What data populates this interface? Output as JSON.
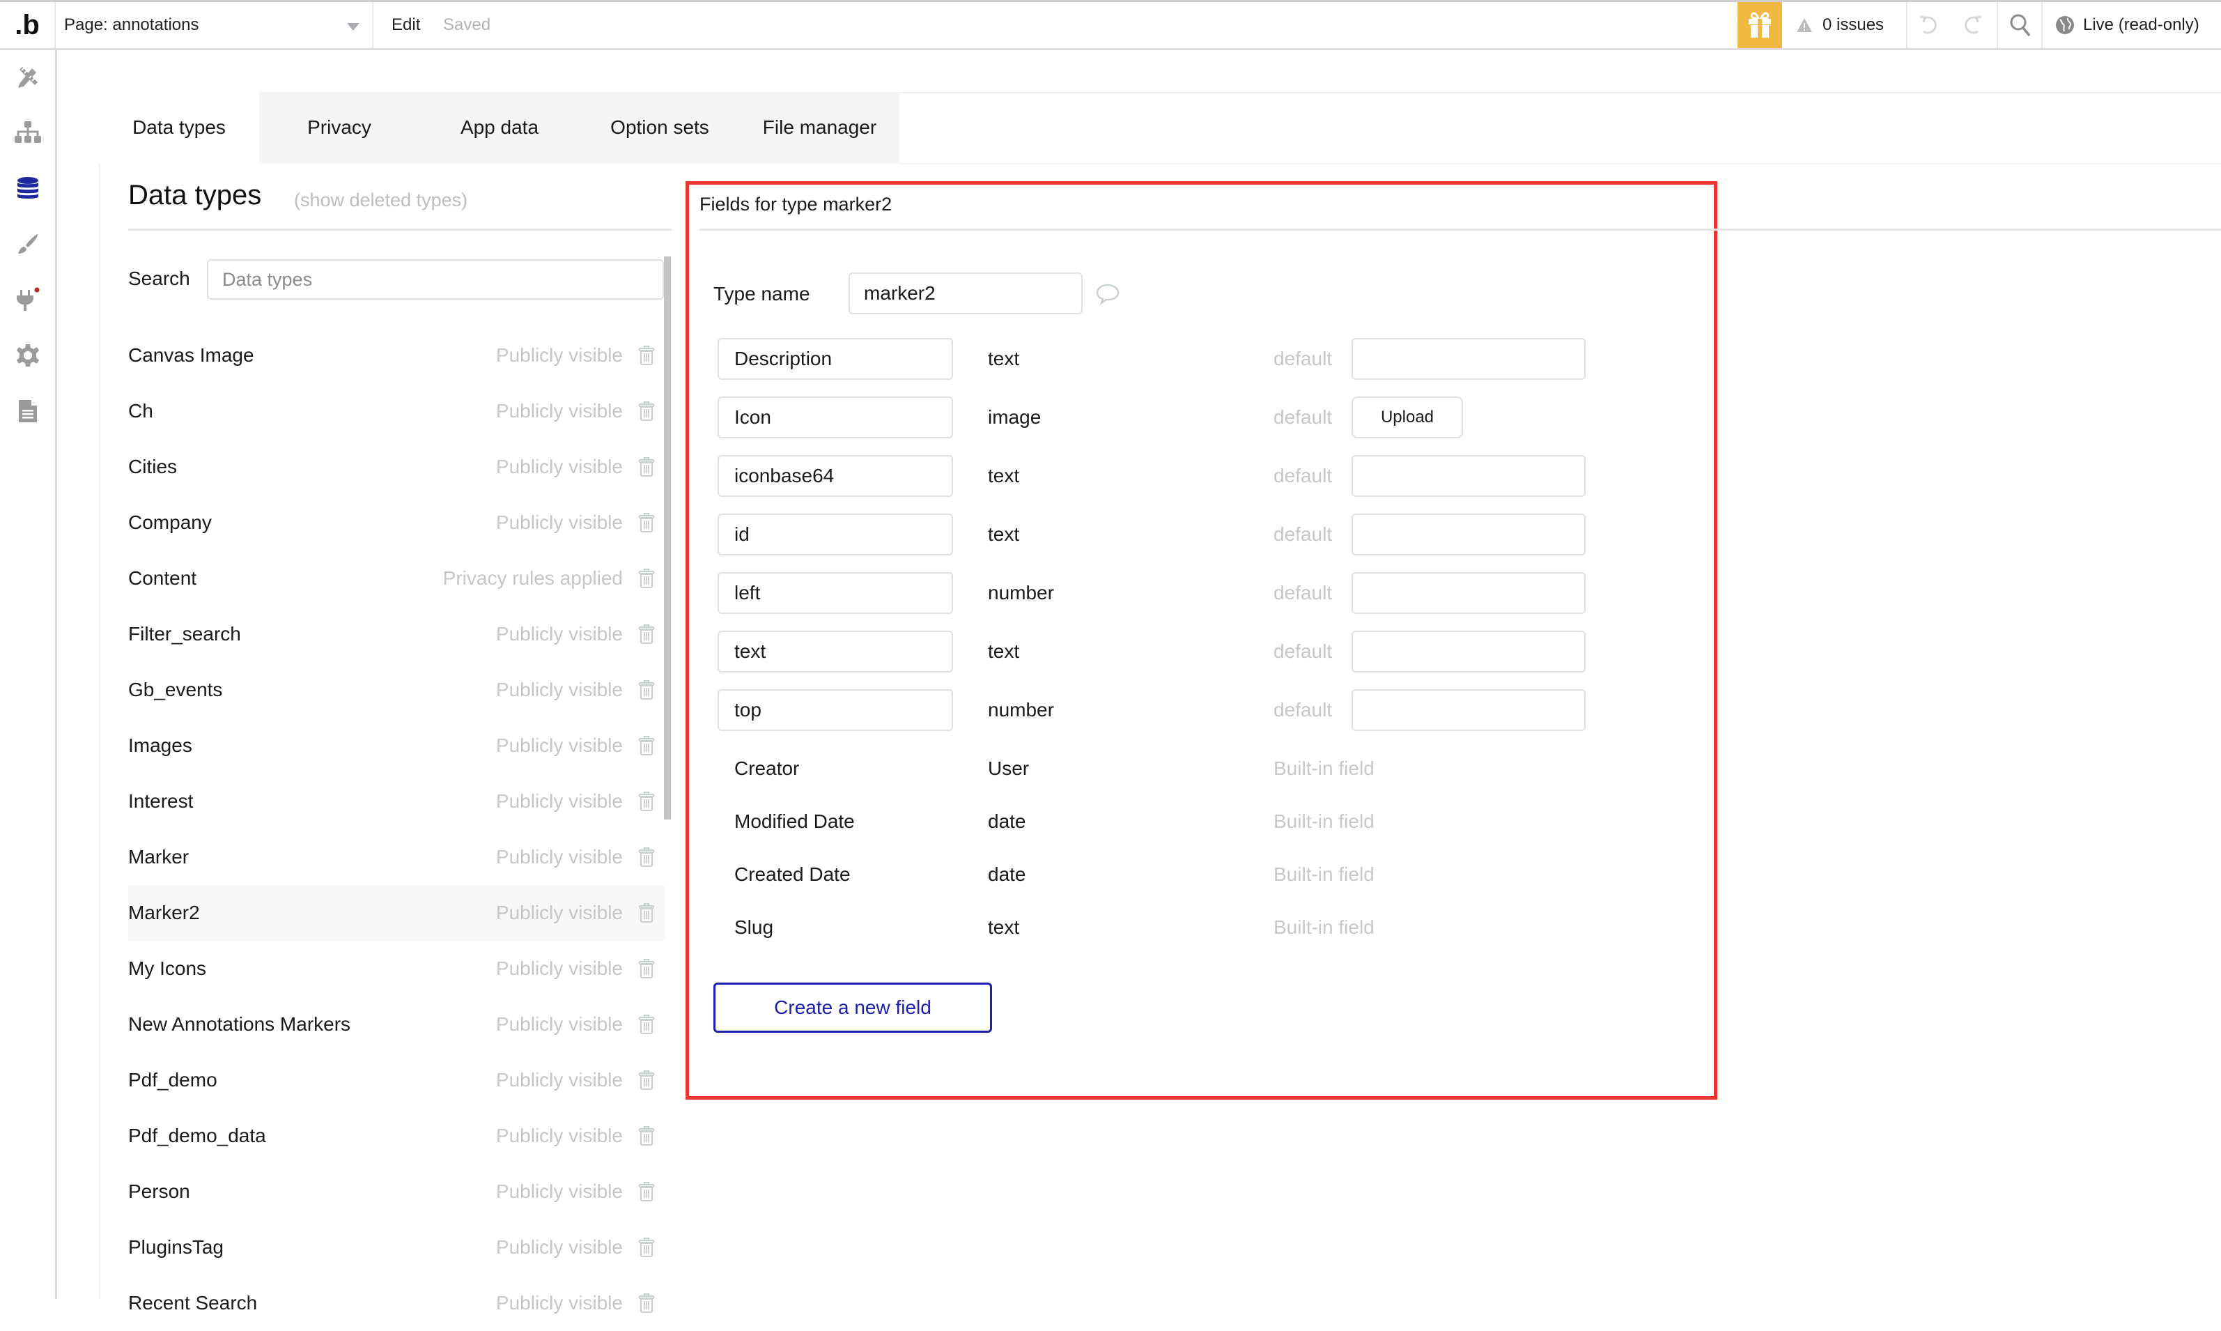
{
  "topbar": {
    "logo": ".b",
    "page_selector": "Page: annotations",
    "edit_label": "Edit",
    "saved_label": "Saved",
    "gift_icon": "gift-icon",
    "issues_label": "0 issues",
    "live_label": "Live (read-only)",
    "accent_color": "#f0b942"
  },
  "rail": {
    "items": [
      {
        "icon": "design-pencil-ruler-icon",
        "active": false
      },
      {
        "icon": "workflow-sitemap-icon",
        "active": false
      },
      {
        "icon": "database-icon",
        "active": true
      },
      {
        "icon": "styles-brush-icon",
        "active": false
      },
      {
        "icon": "plugins-plug-icon",
        "active": false,
        "badge": true
      },
      {
        "icon": "settings-gear-icon",
        "active": false
      },
      {
        "icon": "logs-document-icon",
        "active": false
      }
    ],
    "active_color": "#1b2b9e"
  },
  "tabs": [
    {
      "label": "Data types",
      "active": true
    },
    {
      "label": "Privacy",
      "active": false
    },
    {
      "label": "App data",
      "active": false
    },
    {
      "label": "Option sets",
      "active": false
    },
    {
      "label": "File manager",
      "active": false
    }
  ],
  "datatypes": {
    "title": "Data types",
    "show_deleted": "(show deleted types)",
    "search_label": "Search",
    "search_placeholder": "Data types",
    "search_value": "",
    "items": [
      {
        "name": "Canvas Image",
        "visibility": "Publicly visible"
      },
      {
        "name": "Ch",
        "visibility": "Publicly visible"
      },
      {
        "name": "Cities",
        "visibility": "Publicly visible"
      },
      {
        "name": "Company",
        "visibility": "Publicly visible"
      },
      {
        "name": "Content",
        "visibility": "Privacy rules applied"
      },
      {
        "name": "Filter_search",
        "visibility": "Publicly visible"
      },
      {
        "name": "Gb_events",
        "visibility": "Publicly visible"
      },
      {
        "name": "Images",
        "visibility": "Publicly visible"
      },
      {
        "name": "Interest",
        "visibility": "Publicly visible"
      },
      {
        "name": "Marker",
        "visibility": "Publicly visible"
      },
      {
        "name": "Marker2",
        "visibility": "Publicly visible",
        "selected": true
      },
      {
        "name": "My Icons",
        "visibility": "Publicly visible"
      },
      {
        "name": "New Annotations Markers",
        "visibility": "Publicly visible"
      },
      {
        "name": "Pdf_demo",
        "visibility": "Publicly visible"
      },
      {
        "name": "Pdf_demo_data",
        "visibility": "Publicly visible"
      },
      {
        "name": "Person",
        "visibility": "Publicly visible"
      },
      {
        "name": "PluginsTag",
        "visibility": "Publicly visible"
      },
      {
        "name": "Recent Search",
        "visibility": "Publicly visible"
      }
    ]
  },
  "fields": {
    "title": "Fields for type marker2",
    "type_name_label": "Type name",
    "type_name_value": "marker2",
    "default_label": "default",
    "upload_label": "Upload",
    "custom": [
      {
        "name": "Description",
        "type": "text",
        "default_kind": "input",
        "default_value": ""
      },
      {
        "name": "Icon",
        "type": "image",
        "default_kind": "upload",
        "default_value": ""
      },
      {
        "name": "iconbase64",
        "type": "text",
        "default_kind": "input",
        "default_value": ""
      },
      {
        "name": "id",
        "type": "text",
        "default_kind": "input",
        "default_value": ""
      },
      {
        "name": "left",
        "type": "number",
        "default_kind": "input",
        "default_value": ""
      },
      {
        "name": "text",
        "type": "text",
        "default_kind": "input",
        "default_value": ""
      },
      {
        "name": "top",
        "type": "number",
        "default_kind": "input",
        "default_value": ""
      }
    ],
    "builtin_tag": "Built-in field",
    "builtin": [
      {
        "name": "Creator",
        "type": "User"
      },
      {
        "name": "Modified Date",
        "type": "date"
      },
      {
        "name": "Created Date",
        "type": "date"
      },
      {
        "name": "Slug",
        "type": "text"
      }
    ],
    "create_button": "Create a new field",
    "highlight_color": "#e8382b",
    "button_color": "#1b1fb0"
  }
}
